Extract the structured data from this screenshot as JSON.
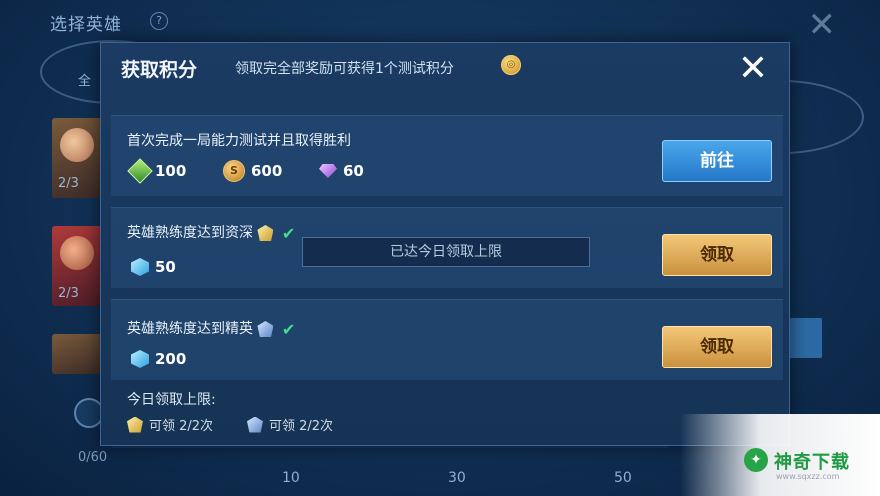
{
  "background": {
    "title": "选择英雄",
    "help": "?",
    "close": "✕",
    "tab": "全",
    "hero_counts": [
      "2/3",
      "2/3"
    ],
    "score": "0/60",
    "ticks": [
      "10",
      "30",
      "50"
    ]
  },
  "dialog": {
    "title": "获取积分",
    "subtitle": "领取完全部奖励可获得1个测试积分",
    "close": "✕",
    "tasks": [
      {
        "title": "首次完成一局能力测试并且取得胜利",
        "rewards": [
          {
            "icon": "green-gem-icon",
            "value": "100"
          },
          {
            "icon": "gold-coin-icon",
            "value": "600"
          },
          {
            "icon": "purple-diamond-icon",
            "value": "60"
          }
        ],
        "button": "前往",
        "button_style": "blue"
      },
      {
        "title": "英雄熟练度达到资深",
        "rewards": [
          {
            "icon": "blue-crystal-icon",
            "value": "50"
          }
        ],
        "button": "领取",
        "button_style": "gold"
      },
      {
        "title": "英雄熟练度达到精英",
        "rewards": [
          {
            "icon": "blue-crystal-icon",
            "value": "200"
          }
        ],
        "button": "领取",
        "button_style": "gold"
      }
    ],
    "tooltip": "已达今日领取上限",
    "limit": {
      "title": "今日领取上限:",
      "items": [
        "可领 2/2次",
        "可领 2/2次"
      ]
    }
  },
  "watermark": {
    "text": "神奇下载",
    "url": "www.sqxzz.com"
  },
  "colors": {
    "accent_blue": "#2578c9",
    "accent_gold": "#c9913f",
    "check_green": "#3ee08a"
  }
}
